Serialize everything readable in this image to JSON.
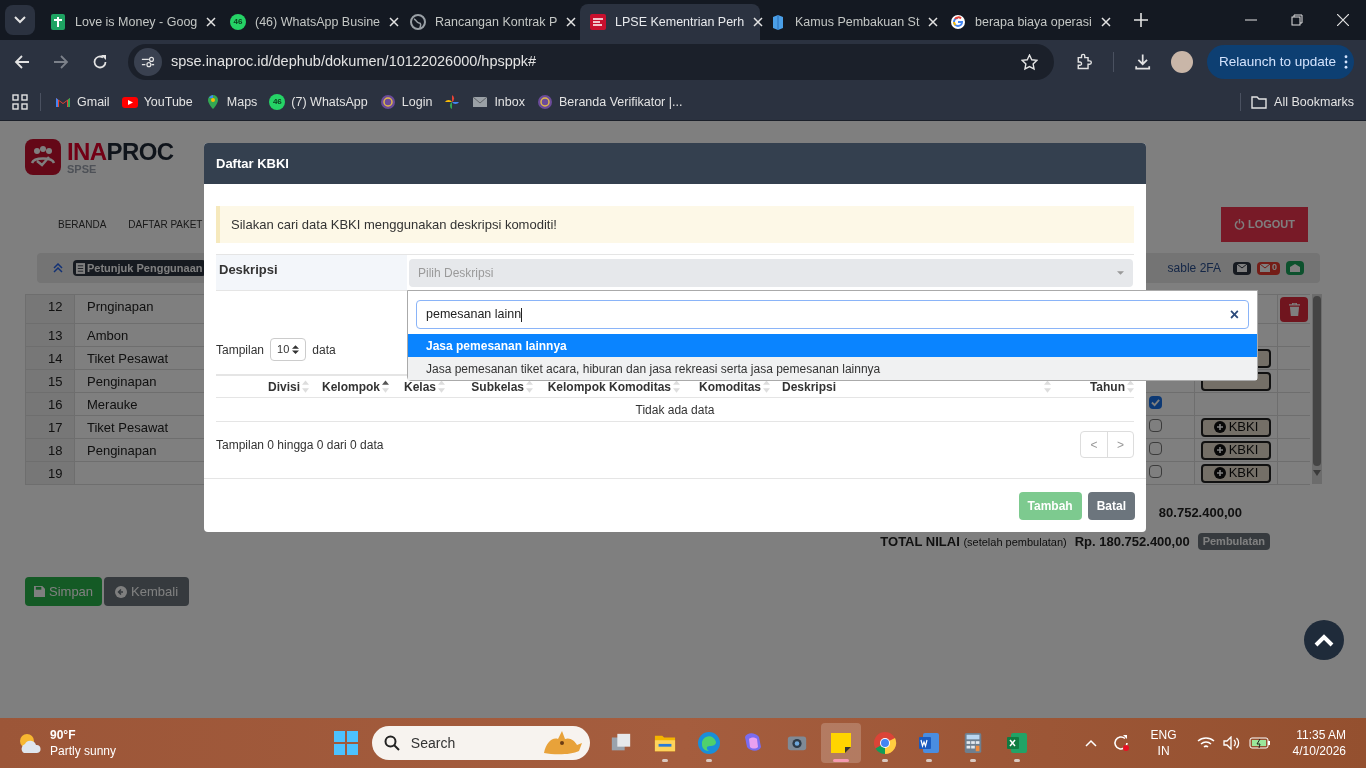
{
  "browser": {
    "tabs": [
      {
        "title": "Love is Money - Goog",
        "kind": "sheets",
        "selected": false
      },
      {
        "title": "(46) WhatsApp Busine",
        "kind": "whatsapp",
        "badge": "46",
        "selected": false
      },
      {
        "title": "Rancangan Kontrak P",
        "kind": "globe",
        "selected": false
      },
      {
        "title": "LPSE Kementrian Perh",
        "kind": "lpse",
        "selected": true
      },
      {
        "title": "Kamus Pembakuan St",
        "kind": "book",
        "selected": false
      },
      {
        "title": "berapa biaya operasi",
        "kind": "google",
        "selected": false
      }
    ],
    "url": "spse.inaproc.id/dephub/dokumen/10122026000/hpsppk#",
    "relaunch": "Relaunch to update",
    "bookmarks": [
      {
        "label": "Gmail",
        "kind": "gmail"
      },
      {
        "label": "YouTube",
        "kind": "youtube"
      },
      {
        "label": "Maps",
        "kind": "maps"
      },
      {
        "label": "(7) WhatsApp",
        "kind": "whatsapp",
        "badge": "46"
      },
      {
        "label": "Login",
        "kind": "emblem"
      },
      {
        "kind": "pinwheel"
      },
      {
        "label": "Inbox",
        "kind": "mail"
      },
      {
        "label": "Beranda Verifikator |...",
        "kind": "emblem"
      }
    ],
    "all_bookmarks": "All Bookmarks"
  },
  "page": {
    "logo": {
      "accent": "INA",
      "rest": "PROC",
      "sub": "SPSE"
    },
    "nav": [
      "BERANDA",
      "DAFTAR PAKET"
    ],
    "logout": "LOGOUT",
    "guide": "Petunjuk Penggunaan",
    "twofa": "sable 2FA",
    "inbox_count": "0",
    "rows": [
      {
        "no": "12",
        "name": "Prnginapan",
        "kind": "delete"
      },
      {
        "no": "13",
        "name": "Ambon",
        "kind": "plain"
      },
      {
        "no": "14",
        "name": "Tiket Pesawat",
        "kind": "kbki"
      },
      {
        "no": "15",
        "name": "Penginapan",
        "kind": "kbki"
      },
      {
        "no": "16",
        "name": "Merauke",
        "kind": "plain",
        "checked": true
      },
      {
        "no": "17",
        "name": "Tiket Pesawat",
        "checked": false,
        "kind": "kbki",
        "action_label": "KBKI"
      },
      {
        "no": "18",
        "name": "Penginapan",
        "checked": false,
        "kind": "kbki",
        "action_label": "KBKI"
      },
      {
        "no": "19",
        "checked": false,
        "kind": "kbki",
        "action_label": "KBKI"
      }
    ],
    "subtotal": "80.752.400,00",
    "total_label": "TOTAL NILAI",
    "total_note": "(setelah pembulatan)",
    "total": "Rp. 180.752.400,00",
    "rounding": "Pembulatan",
    "save": "Simpan",
    "back": "Kembali"
  },
  "modal": {
    "title": "Daftar KBKI",
    "alert": "Silakan cari data KBKI menggunakan deskripsi komoditi!",
    "field_label": "Deskripsi",
    "select_placeholder": "Pilih Deskripsi",
    "length_prefix": "Tampilan",
    "length_value": "10",
    "length_suffix": "data",
    "columns": [
      {
        "label": "Divisi",
        "sorted": false
      },
      {
        "label": "Kelompok",
        "sorted": true
      },
      {
        "label": "Kelas",
        "sorted": false
      },
      {
        "label": "Subkelas",
        "sorted": false
      },
      {
        "label": "Kelompok Komoditas",
        "sorted": false
      },
      {
        "label": "Komoditas",
        "sorted": false
      },
      {
        "label": "Deskripsi",
        "sorted": false
      },
      {
        "label": "Tahun",
        "sorted": false
      }
    ],
    "empty": "Tidak ada data",
    "info": "Tampilan 0 hingga 0 dari 0 data",
    "pager": [
      "<",
      ">"
    ],
    "buttons": [
      {
        "label": "Tambah",
        "kind": "primary",
        "disabled": true
      },
      {
        "label": "Batal",
        "kind": "secondary",
        "disabled": false
      }
    ]
  },
  "dropdown": {
    "search": "pemesanan lainn",
    "clear": "×",
    "options": [
      {
        "label": "Jasa pemesanan lainnya",
        "selected": true
      },
      {
        "label": "Jasa pemesanan tiket acara, hiburan dan jasa rekreasi serta jasa pemesanan lainnya",
        "selected": false
      }
    ]
  },
  "taskbar": {
    "weather": {
      "temp": "90°F",
      "desc": "Partly sunny"
    },
    "search": "Search",
    "apps": [
      {
        "kind": "taskview",
        "running": false,
        "selected": false
      },
      {
        "kind": "files",
        "running": true,
        "selected": false
      },
      {
        "kind": "edge",
        "running": true,
        "selected": false
      },
      {
        "kind": "copilot",
        "running": false,
        "selected": false
      },
      {
        "kind": "camera",
        "running": false,
        "selected": false
      },
      {
        "kind": "notes",
        "running": true,
        "selected": true
      },
      {
        "kind": "chrome",
        "running": true,
        "selected": false
      },
      {
        "kind": "word",
        "running": true,
        "selected": false
      },
      {
        "kind": "calculator",
        "running": true,
        "selected": false
      },
      {
        "kind": "excel",
        "running": true,
        "selected": false
      }
    ],
    "lang": "ENG",
    "region": "IN",
    "time": "11:35 AM",
    "date": "4/10/2026"
  }
}
